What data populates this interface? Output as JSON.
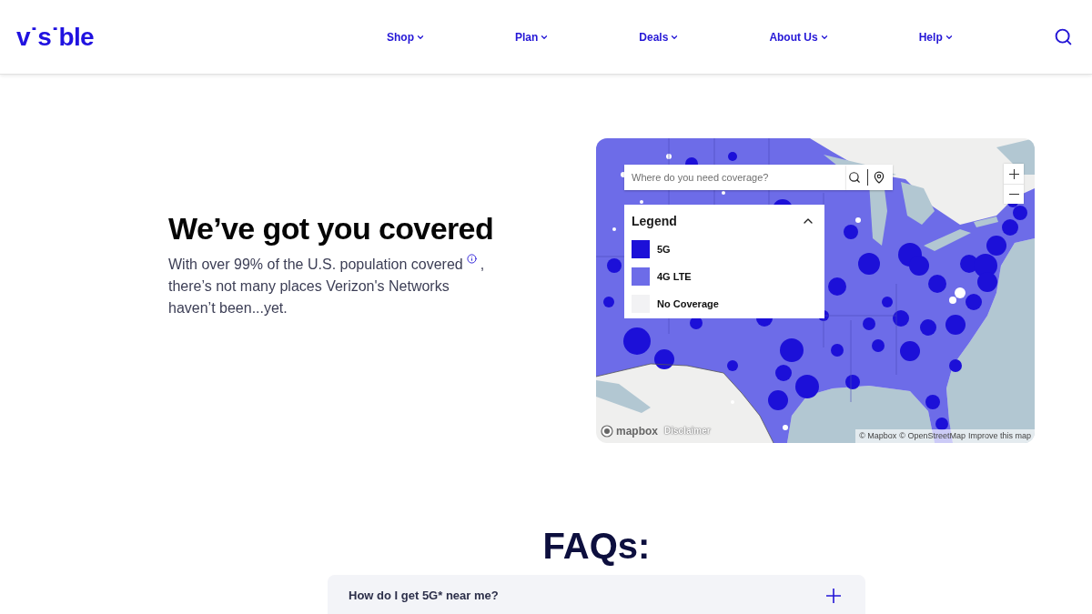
{
  "header": {
    "logo": "v˙s˙ble",
    "nav": [
      "Shop",
      "Plan",
      "Deals",
      "About Us",
      "Help"
    ]
  },
  "hero": {
    "title": "We’ve got you covered",
    "intro": [
      "With over 99% of the U.S. population covered",
      ", there’s not many places Verizon's Networks haven’t been...yet."
    ]
  },
  "coverage_map": {
    "search": {
      "placeholder": "Where do you need coverage?"
    },
    "legend": {
      "title": "Legend",
      "expanded": true,
      "items": [
        {
          "label": "5G",
          "color": "#1c10d8"
        },
        {
          "label": "4G LTE",
          "color": "#6d6ce8"
        },
        {
          "label": "No Coverage",
          "color": "#f2f2f4"
        }
      ]
    },
    "logo": "mapbox",
    "disclaimer": "Disclaimer",
    "attribution": [
      "© Mapbox",
      "© OpenStreetMap",
      "Improve this map"
    ]
  },
  "faqs": {
    "title": "FAQs:",
    "items": [
      {
        "question": "How do I get 5G* near me?",
        "expanded": false
      }
    ]
  }
}
